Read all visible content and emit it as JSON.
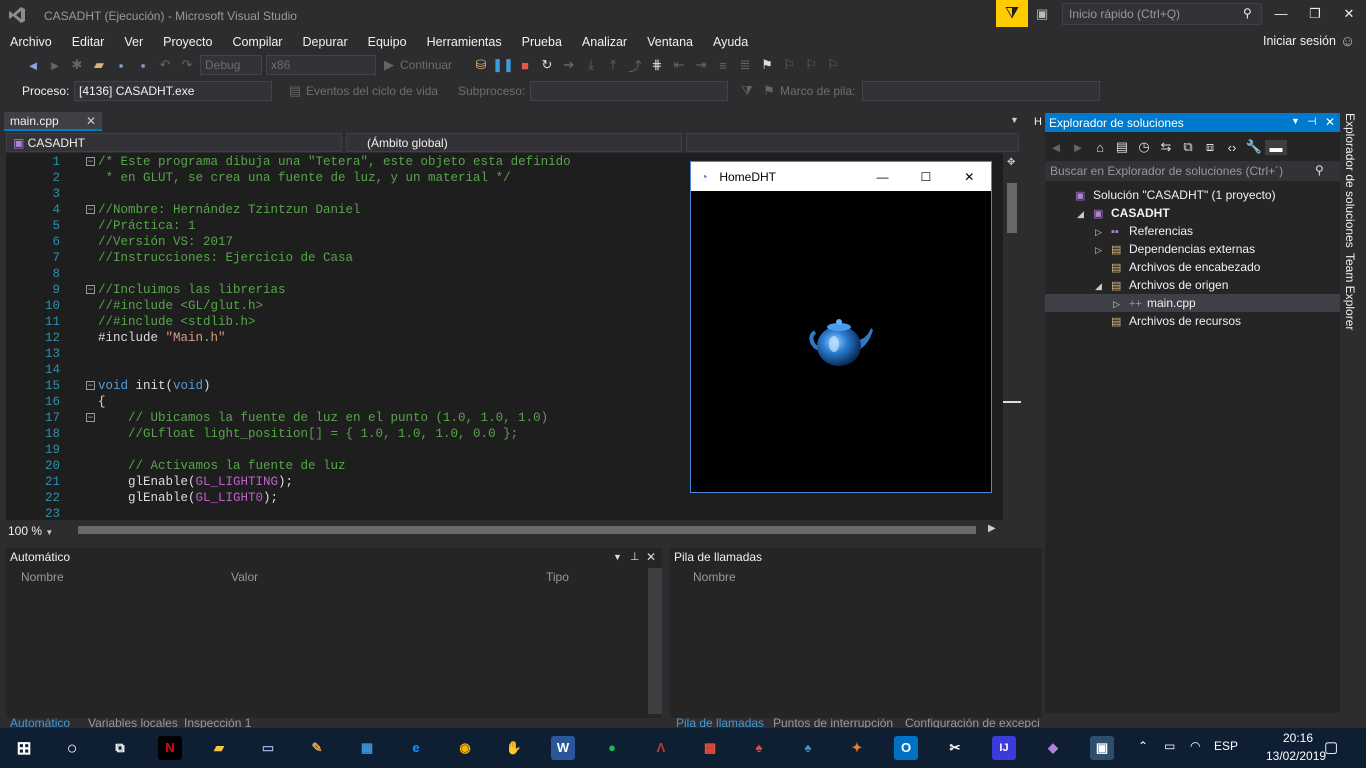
{
  "window": {
    "title": "CASADHT (Ejecución) - Microsoft Visual Studio"
  },
  "quick_launch": {
    "placeholder": "Inicio rápido (Ctrl+Q)"
  },
  "menu": [
    "Archivo",
    "Editar",
    "Ver",
    "Proyecto",
    "Compilar",
    "Depurar",
    "Equipo",
    "Herramientas",
    "Prueba",
    "Analizar",
    "Ventana",
    "Ayuda"
  ],
  "account": {
    "signin": "Iniciar sesión"
  },
  "toolbar": {
    "config": "Debug",
    "platform": "x86",
    "continue": "Continuar"
  },
  "procbar": {
    "process_label": "Proceso:",
    "process_value": "[4136] CASADHT.exe",
    "lifecycle": "Eventos del ciclo de vida",
    "thread_label": "Subproceso:",
    "stack_label": "Marco de pila:"
  },
  "editor": {
    "tab": "main.cpp",
    "project": "CASADHT",
    "scope": "(Ámbito global)",
    "zoom": "100 %",
    "lines": [
      {
        "n": "1",
        "parts": [
          [
            "c-com",
            "/* Este programa dibuja una \"Tetera\", este objeto esta definido"
          ]
        ],
        "fold": true
      },
      {
        "n": "2",
        "parts": [
          [
            "c-com",
            " * en GLUT, se crea una fuente de luz, y un material */"
          ]
        ]
      },
      {
        "n": "3",
        "parts": []
      },
      {
        "n": "4",
        "parts": [
          [
            "c-com",
            "//Nombre: Hernández Tzintzun Daniel"
          ]
        ],
        "fold": true
      },
      {
        "n": "5",
        "parts": [
          [
            "c-com",
            "//Práctica: 1"
          ]
        ]
      },
      {
        "n": "6",
        "parts": [
          [
            "c-com",
            "//Versión VS: 2017"
          ]
        ]
      },
      {
        "n": "7",
        "parts": [
          [
            "c-com",
            "//Instrucciones: Ejercicio de Casa"
          ]
        ]
      },
      {
        "n": "8",
        "parts": []
      },
      {
        "n": "9",
        "parts": [
          [
            "c-com",
            "//Incluimos las librerias"
          ]
        ],
        "fold": true
      },
      {
        "n": "10",
        "parts": [
          [
            "c-com",
            "//#include <GL/glut.h>"
          ]
        ]
      },
      {
        "n": "11",
        "parts": [
          [
            "c-com",
            "//#include <stdlib.h>"
          ]
        ]
      },
      {
        "n": "12",
        "parts": [
          [
            "c-plain",
            "#include "
          ],
          [
            "c-str",
            "\"Main.h\""
          ]
        ]
      },
      {
        "n": "13",
        "parts": []
      },
      {
        "n": "14",
        "parts": []
      },
      {
        "n": "15",
        "parts": [
          [
            "c-kw",
            "void"
          ],
          [
            "c-plain",
            " init("
          ],
          [
            "c-kw",
            "void"
          ],
          [
            "c-plain",
            ")"
          ]
        ],
        "fold": true
      },
      {
        "n": "16",
        "parts": [
          [
            "c-plain",
            "{"
          ]
        ]
      },
      {
        "n": "17",
        "parts": [
          [
            "c-com",
            "    // Ubicamos la fuente de luz en el punto (1.0, 1.0, 1.0)"
          ]
        ],
        "fold": true
      },
      {
        "n": "18",
        "parts": [
          [
            "c-com",
            "    //GLfloat light_position[] = { 1.0, 1.0, 1.0, 0.0 };"
          ]
        ]
      },
      {
        "n": "19",
        "parts": []
      },
      {
        "n": "20",
        "parts": [
          [
            "c-com",
            "    // Activamos la fuente de luz"
          ]
        ]
      },
      {
        "n": "21",
        "parts": [
          [
            "c-plain",
            "    glEnable("
          ],
          [
            "c-mac",
            "GL_LIGHTING"
          ],
          [
            "c-plain",
            ");"
          ]
        ]
      },
      {
        "n": "22",
        "parts": [
          [
            "c-plain",
            "    glEnable("
          ],
          [
            "c-mac",
            "GL_LIGHT0"
          ],
          [
            "c-plain",
            ");"
          ]
        ]
      },
      {
        "n": "23",
        "parts": []
      }
    ]
  },
  "homedht": {
    "title": "HomeDHT"
  },
  "solution_explorer": {
    "title": "Explorador de soluciones",
    "search_placeholder": "Buscar en Explorador de soluciones (Ctrl+´)",
    "items": [
      {
        "label": "Solución \"CASADHT\"  (1 proyecto)",
        "level": 0,
        "arrow": "",
        "icon": "▣"
      },
      {
        "label": "CASADHT",
        "level": 1,
        "arrow": "◢",
        "icon": "▣",
        "bold": true
      },
      {
        "label": "Referencias",
        "level": 2,
        "arrow": "▷",
        "icon": "▪▪"
      },
      {
        "label": "Dependencias externas",
        "level": 2,
        "arrow": "▷",
        "icon": "▤"
      },
      {
        "label": "Archivos de encabezado",
        "level": 2,
        "arrow": "",
        "icon": "▤"
      },
      {
        "label": "Archivos de origen",
        "level": 2,
        "arrow": "◢",
        "icon": "▤"
      },
      {
        "label": "main.cpp",
        "level": 3,
        "arrow": "▷",
        "icon": "++",
        "selected": true
      },
      {
        "label": "Archivos de recursos",
        "level": 2,
        "arrow": "",
        "icon": "▤"
      }
    ]
  },
  "vertical_tabs": [
    "Explorador de soluciones",
    "Team Explorer"
  ],
  "auto_panel": {
    "title": "Automático",
    "columns": [
      "Nombre",
      "Valor",
      "Tipo"
    ],
    "tabs": [
      "Automático",
      "Variables locales",
      "Inspección 1"
    ]
  },
  "callstack_panel": {
    "title": "Pila de llamadas",
    "columns": [
      "Nombre"
    ],
    "tabs": [
      "Pila de llamadas",
      "Puntos de interrupción",
      "Configuración de excepci"
    ]
  },
  "taskbar": {
    "lang": "ESP",
    "time": "20:16",
    "date": "13/02/2019"
  },
  "colors": {
    "accent": "#007acc",
    "editor_bg": "#1e1e1e",
    "chrome_bg": "#2d2d30"
  }
}
